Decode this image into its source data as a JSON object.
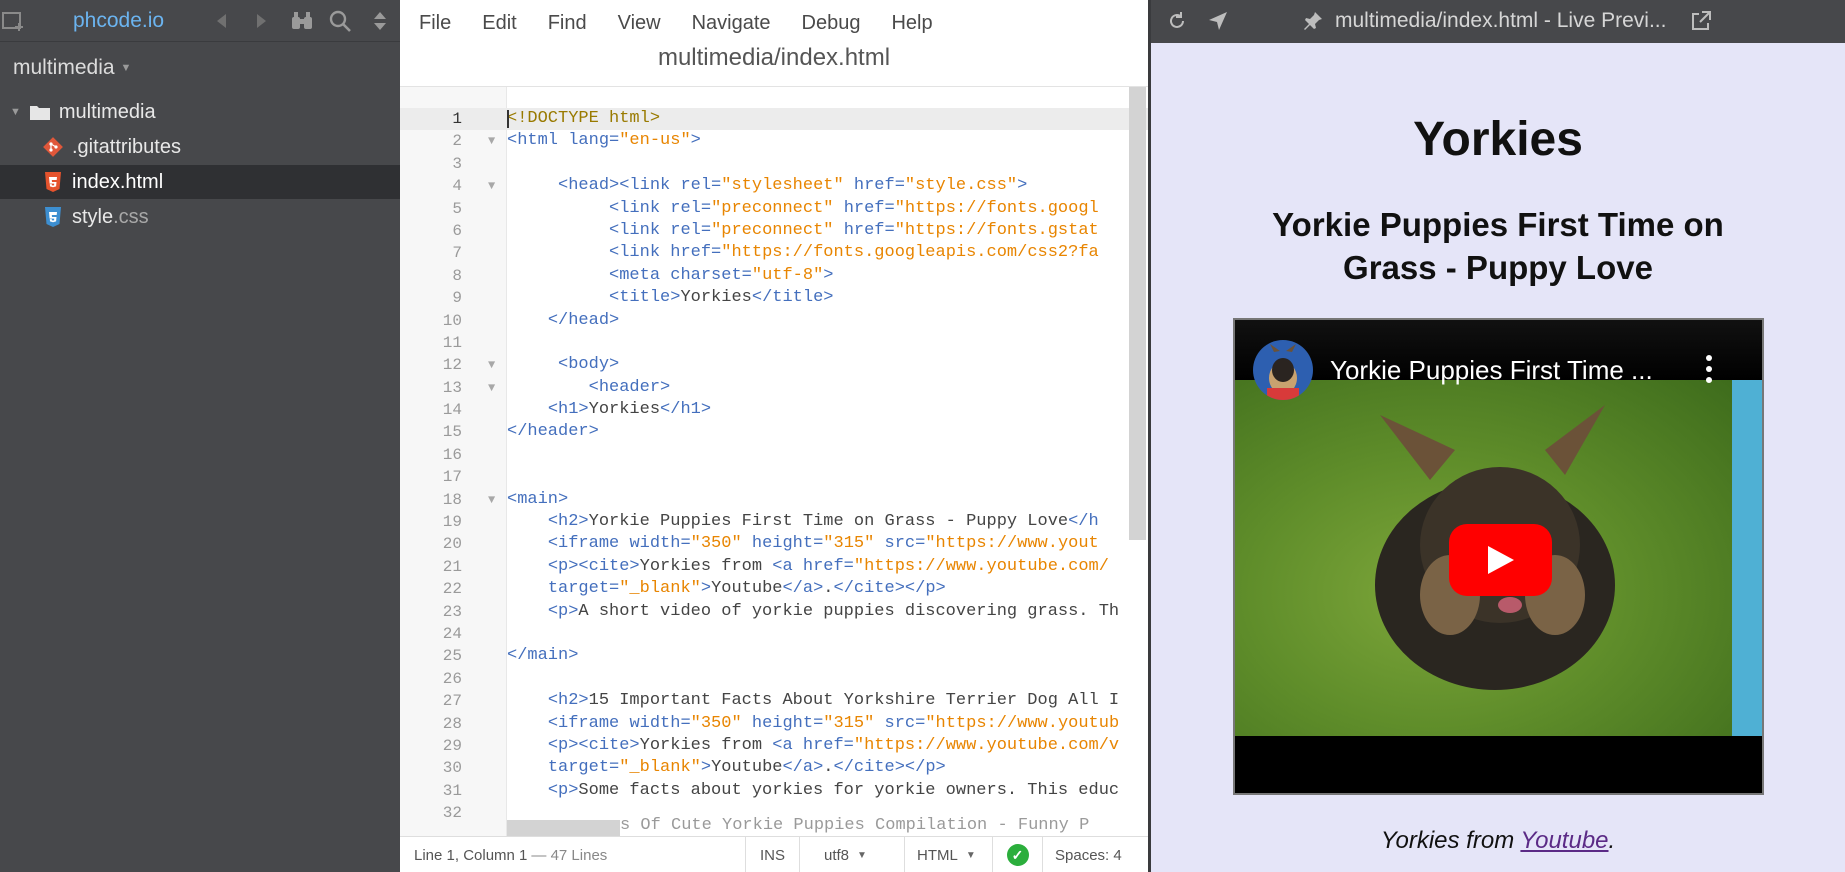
{
  "sidebar": {
    "brand": "phcode.io",
    "project": "multimedia",
    "tree": [
      {
        "label": "multimedia",
        "type": "folder"
      },
      {
        "name": ".gitattributes",
        "ext": "",
        "type": "git"
      },
      {
        "name": "index",
        "ext": ".html",
        "type": "html",
        "selected": true
      },
      {
        "name": "style",
        "ext": ".css",
        "type": "css"
      }
    ]
  },
  "editor": {
    "menu": [
      "File",
      "Edit",
      "Find",
      "View",
      "Navigate",
      "Debug",
      "Help"
    ],
    "doc_title": "multimedia/index.html",
    "lines": [
      "1",
      "2",
      "3",
      "4",
      "5",
      "6",
      "7",
      "8",
      "9",
      "10",
      "11",
      "12",
      "13",
      "14",
      "15",
      "16",
      "17",
      "18",
      "19",
      "20",
      "21",
      "22",
      "23",
      "24",
      "25",
      "26",
      "27",
      "28",
      "29",
      "30",
      "31",
      "32"
    ],
    "code": {
      "l1": "<!DOCTYPE html>",
      "l2_tag": "<html",
      "l2_attr": "lang=",
      "l2_val": "\"en-us\"",
      "l2_end": ">",
      "l4_head": "<head>",
      "l4_link": "<link",
      "l4_rel": "rel=",
      "l4_relv": "\"stylesheet\"",
      "l4_href": "href=",
      "l4_hrefv": "\"style.css\"",
      "l4_end": ">",
      "l5_link": "<link",
      "l5_rel": "rel=",
      "l5_relv": "\"preconnect\"",
      "l5_href": "href=",
      "l5_hrefv": "\"https://fonts.googl",
      "l6_link": "<link",
      "l6_rel": "rel=",
      "l6_relv": "\"preconnect\"",
      "l6_href": "href=",
      "l6_hrefv": "\"https://fonts.gstat",
      "l7_link": "<link",
      "l7_href": "href=",
      "l7_hrefv": "\"https://fonts.googleapis.com/css2?fa",
      "l8_meta": "<meta",
      "l8_cs": "charset=",
      "l8_csv": "\"utf-8\"",
      "l8_end": ">",
      "l9_open": "<title>",
      "l9_text": "Yorkies",
      "l9_close": "</title>",
      "l10": "</head>",
      "l12": "<body>",
      "l13": "<header>",
      "l14_open": "<h1>",
      "l14_text": "Yorkies",
      "l14_close": "</h1>",
      "l15": "</header>",
      "l18": "<main>",
      "l19_open": "<h2>",
      "l19_text": "Yorkie Puppies First Time on Grass - Puppy Love",
      "l19_close": "</h",
      "l20_tag": "<iframe",
      "l20_w": "width=",
      "l20_wv": "\"350\"",
      "l20_h": "height=",
      "l20_hv": "\"315\"",
      "l20_src": "src=",
      "l20_srcv": "\"https://www.yout",
      "l21_p": "<p><cite>",
      "l21_text": "Yorkies from ",
      "l21_a": "<a",
      "l21_href": "href=",
      "l21_hrefv": "\"https://www.youtube.com/",
      "l22_t": "target=",
      "l22_tv": "\"_blank\"",
      "l22_gt": ">",
      "l22_text": "Youtube",
      "l22_close_a": "</a>",
      "l22_dot": ".",
      "l22_close": "</cite></p>",
      "l23_p": "<p>",
      "l23_text": "A short video of yorkie puppies discovering grass. Th",
      "l25": "</main>",
      "l27_open": "<h2>",
      "l27_text": "15 Important Facts About Yorkshire Terrier Dog All I",
      "l28_tag": "<iframe",
      "l28_w": "width=",
      "l28_wv": "\"350\"",
      "l28_h": "height=",
      "l28_hv": "\"315\"",
      "l28_src": "src=",
      "l28_srcv": "\"https://www.youtub",
      "l29_p": "<p><cite>",
      "l29_text": "Yorkies from ",
      "l29_a": "<a",
      "l29_href": "href=",
      "l29_hrefv": "\"https://www.youtube.com/v",
      "l30_t": "target=",
      "l30_tv": "\"_blank\"",
      "l30_gt": ">",
      "l30_text": "Youtube",
      "l30_close_a": "</a>",
      "l30_dot": ".",
      "l30_close": "</cite></p>",
      "l31_p": "<p>",
      "l31_text": "Some facts about yorkies for yorkie owners. This educ",
      "l33_partial": "s Of Cute Yorkie Puppies Compilation - Funny P"
    },
    "status": {
      "position": "Line 1, Column 1",
      "lines": "— 47 Lines",
      "mode": "INS",
      "encoding": "utf8",
      "language": "HTML",
      "spaces_label": "Spaces:",
      "spaces_value": "4"
    }
  },
  "preview": {
    "title": "multimedia/index.html - Live Previ...",
    "h1": "Yorkies",
    "h2": "Yorkie Puppies First Time on Grass - Puppy Love",
    "video_title": "Yorkie Puppies First Time ...",
    "cite_prefix": "Yorkies from ",
    "cite_link": "Youtube",
    "cite_suffix": "."
  }
}
